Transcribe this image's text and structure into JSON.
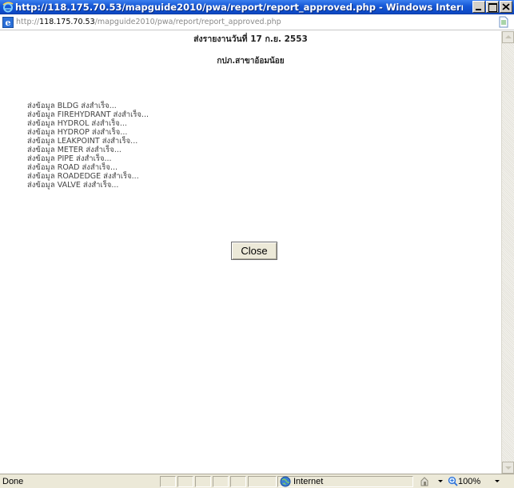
{
  "window": {
    "title": "http://118.175.70.53/mapguide2010/pwa/report/report_approved.php - Windows Internet ..."
  },
  "address": {
    "prefix": "http://",
    "host": "118.175.70.53",
    "path": "/mapguide2010/pwa/report/report_approved.php"
  },
  "report": {
    "title": "ส่งรายงานวันที่ 17 ก.ย. 2553",
    "subtitle": "กปภ.สาขาอ้อมน้อย",
    "items": [
      "ส่งข้อมูล BLDG ส่งสำเร็จ...",
      "ส่งข้อมูล FIREHYDRANT ส่งสำเร็จ...",
      "ส่งข้อมูล HYDROL ส่งสำเร็จ...",
      "ส่งข้อมูล HYDROP ส่งสำเร็จ...",
      "ส่งข้อมูล LEAKPOINT ส่งสำเร็จ...",
      "ส่งข้อมูล METER ส่งสำเร็จ...",
      "ส่งข้อมูล PIPE ส่งสำเร็จ...",
      "ส่งข้อมูล ROAD ส่งสำเร็จ...",
      "ส่งข้อมูล ROADEDGE ส่งสำเร็จ...",
      "ส่งข้อมูล VALVE ส่งสำเร็จ..."
    ],
    "close_label": "Close"
  },
  "statusbar": {
    "status": "Done",
    "zone": "Internet",
    "zoom": "100%"
  },
  "icons": {
    "title": "ie-logo-icon",
    "address": "ie-page-icon",
    "page": "page-icon",
    "zone": "globe-icon",
    "protected": "protected-mode-icon",
    "zoom": "zoom-icon"
  },
  "colors": {
    "titlebar": "#1658d6",
    "chrome": "#ece9d8",
    "host_text": "#000000",
    "path_text": "#8a8a8a"
  }
}
